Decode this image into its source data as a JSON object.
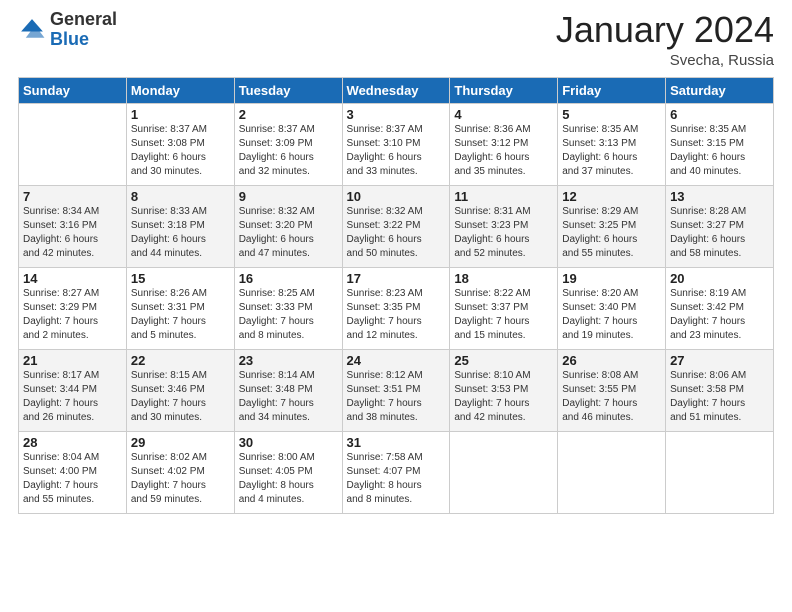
{
  "logo": {
    "general": "General",
    "blue": "Blue"
  },
  "header": {
    "month": "January 2024",
    "location": "Svecha, Russia"
  },
  "weekdays": [
    "Sunday",
    "Monday",
    "Tuesday",
    "Wednesday",
    "Thursday",
    "Friday",
    "Saturday"
  ],
  "weeks": [
    [
      {
        "day": "",
        "info": ""
      },
      {
        "day": "1",
        "info": "Sunrise: 8:37 AM\nSunset: 3:08 PM\nDaylight: 6 hours\nand 30 minutes."
      },
      {
        "day": "2",
        "info": "Sunrise: 8:37 AM\nSunset: 3:09 PM\nDaylight: 6 hours\nand 32 minutes."
      },
      {
        "day": "3",
        "info": "Sunrise: 8:37 AM\nSunset: 3:10 PM\nDaylight: 6 hours\nand 33 minutes."
      },
      {
        "day": "4",
        "info": "Sunrise: 8:36 AM\nSunset: 3:12 PM\nDaylight: 6 hours\nand 35 minutes."
      },
      {
        "day": "5",
        "info": "Sunrise: 8:35 AM\nSunset: 3:13 PM\nDaylight: 6 hours\nand 37 minutes."
      },
      {
        "day": "6",
        "info": "Sunrise: 8:35 AM\nSunset: 3:15 PM\nDaylight: 6 hours\nand 40 minutes."
      }
    ],
    [
      {
        "day": "7",
        "info": "Sunrise: 8:34 AM\nSunset: 3:16 PM\nDaylight: 6 hours\nand 42 minutes."
      },
      {
        "day": "8",
        "info": "Sunrise: 8:33 AM\nSunset: 3:18 PM\nDaylight: 6 hours\nand 44 minutes."
      },
      {
        "day": "9",
        "info": "Sunrise: 8:32 AM\nSunset: 3:20 PM\nDaylight: 6 hours\nand 47 minutes."
      },
      {
        "day": "10",
        "info": "Sunrise: 8:32 AM\nSunset: 3:22 PM\nDaylight: 6 hours\nand 50 minutes."
      },
      {
        "day": "11",
        "info": "Sunrise: 8:31 AM\nSunset: 3:23 PM\nDaylight: 6 hours\nand 52 minutes."
      },
      {
        "day": "12",
        "info": "Sunrise: 8:29 AM\nSunset: 3:25 PM\nDaylight: 6 hours\nand 55 minutes."
      },
      {
        "day": "13",
        "info": "Sunrise: 8:28 AM\nSunset: 3:27 PM\nDaylight: 6 hours\nand 58 minutes."
      }
    ],
    [
      {
        "day": "14",
        "info": "Sunrise: 8:27 AM\nSunset: 3:29 PM\nDaylight: 7 hours\nand 2 minutes."
      },
      {
        "day": "15",
        "info": "Sunrise: 8:26 AM\nSunset: 3:31 PM\nDaylight: 7 hours\nand 5 minutes."
      },
      {
        "day": "16",
        "info": "Sunrise: 8:25 AM\nSunset: 3:33 PM\nDaylight: 7 hours\nand 8 minutes."
      },
      {
        "day": "17",
        "info": "Sunrise: 8:23 AM\nSunset: 3:35 PM\nDaylight: 7 hours\nand 12 minutes."
      },
      {
        "day": "18",
        "info": "Sunrise: 8:22 AM\nSunset: 3:37 PM\nDaylight: 7 hours\nand 15 minutes."
      },
      {
        "day": "19",
        "info": "Sunrise: 8:20 AM\nSunset: 3:40 PM\nDaylight: 7 hours\nand 19 minutes."
      },
      {
        "day": "20",
        "info": "Sunrise: 8:19 AM\nSunset: 3:42 PM\nDaylight: 7 hours\nand 23 minutes."
      }
    ],
    [
      {
        "day": "21",
        "info": "Sunrise: 8:17 AM\nSunset: 3:44 PM\nDaylight: 7 hours\nand 26 minutes."
      },
      {
        "day": "22",
        "info": "Sunrise: 8:15 AM\nSunset: 3:46 PM\nDaylight: 7 hours\nand 30 minutes."
      },
      {
        "day": "23",
        "info": "Sunrise: 8:14 AM\nSunset: 3:48 PM\nDaylight: 7 hours\nand 34 minutes."
      },
      {
        "day": "24",
        "info": "Sunrise: 8:12 AM\nSunset: 3:51 PM\nDaylight: 7 hours\nand 38 minutes."
      },
      {
        "day": "25",
        "info": "Sunrise: 8:10 AM\nSunset: 3:53 PM\nDaylight: 7 hours\nand 42 minutes."
      },
      {
        "day": "26",
        "info": "Sunrise: 8:08 AM\nSunset: 3:55 PM\nDaylight: 7 hours\nand 46 minutes."
      },
      {
        "day": "27",
        "info": "Sunrise: 8:06 AM\nSunset: 3:58 PM\nDaylight: 7 hours\nand 51 minutes."
      }
    ],
    [
      {
        "day": "28",
        "info": "Sunrise: 8:04 AM\nSunset: 4:00 PM\nDaylight: 7 hours\nand 55 minutes."
      },
      {
        "day": "29",
        "info": "Sunrise: 8:02 AM\nSunset: 4:02 PM\nDaylight: 7 hours\nand 59 minutes."
      },
      {
        "day": "30",
        "info": "Sunrise: 8:00 AM\nSunset: 4:05 PM\nDaylight: 8 hours\nand 4 minutes."
      },
      {
        "day": "31",
        "info": "Sunrise: 7:58 AM\nSunset: 4:07 PM\nDaylight: 8 hours\nand 8 minutes."
      },
      {
        "day": "",
        "info": ""
      },
      {
        "day": "",
        "info": ""
      },
      {
        "day": "",
        "info": ""
      }
    ]
  ]
}
